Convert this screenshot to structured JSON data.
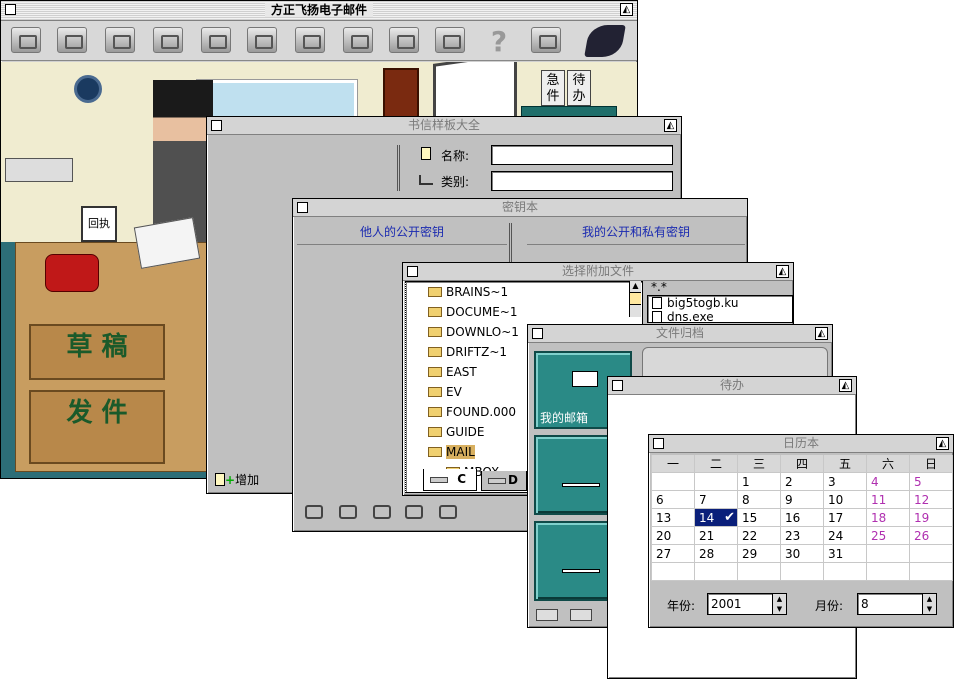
{
  "main": {
    "title": "方正飞扬电子邮件",
    "toolbar_icons": [
      "inbox-icon",
      "address-book-icon",
      "compose-icon",
      "read-mail-icon",
      "reply-icon",
      "forward-icon",
      "notebook-icon",
      "tools-icon",
      "send-receive-icon",
      "print-icon",
      "help-icon",
      "exit-icon",
      "logo-icon"
    ],
    "scene": {
      "receipt_label": "回执",
      "drafts_label": "草 稿",
      "send_label": "发 件",
      "urgent_label": "急件",
      "pending_label": "待办"
    }
  },
  "letter_templates": {
    "title": "书信样板大全",
    "name_label": "名称:",
    "name_value": "",
    "category_label": "类别:",
    "category_value": "",
    "add_label": "增加"
  },
  "keyring": {
    "title": "密钥本",
    "others_public_keys": "他人的公开密钥",
    "my_keys": "我的公开和私有密钥"
  },
  "attach": {
    "title": "选择附加文件",
    "folders": [
      "BRAINS~1",
      "DOCUME~1",
      "DOWNLO~1",
      "DRIFTZ~1",
      "EAST",
      "EV",
      "FOUND.000",
      "GUIDE",
      "MAIL",
      "MBOX"
    ],
    "selected_folder": "MAIL",
    "filter": "*.*",
    "files": [
      "big5togb.ku",
      "dns.exe"
    ],
    "drives": [
      "C",
      "D"
    ]
  },
  "archive": {
    "title": "文件归档",
    "my_mailbox": "我的邮箱"
  },
  "todo": {
    "title": "待办"
  },
  "calendar": {
    "title": "日历本",
    "weekdays": [
      "一",
      "二",
      "三",
      "四",
      "五",
      "六",
      "日"
    ],
    "weeks": [
      [
        "",
        "",
        "1",
        "2",
        "3",
        "4",
        "5"
      ],
      [
        "6",
        "7",
        "8",
        "9",
        "10",
        "11",
        "12"
      ],
      [
        "13",
        "14",
        "15",
        "16",
        "17",
        "18",
        "19"
      ],
      [
        "20",
        "21",
        "22",
        "23",
        "24",
        "25",
        "26"
      ],
      [
        "27",
        "28",
        "29",
        "30",
        "31",
        "",
        ""
      ],
      [
        "",
        "",
        "",
        "",
        "",
        "",
        ""
      ]
    ],
    "selected_day": "14",
    "year_label": "年份:",
    "year": "2001",
    "month_label": "月份:",
    "month": "8"
  }
}
